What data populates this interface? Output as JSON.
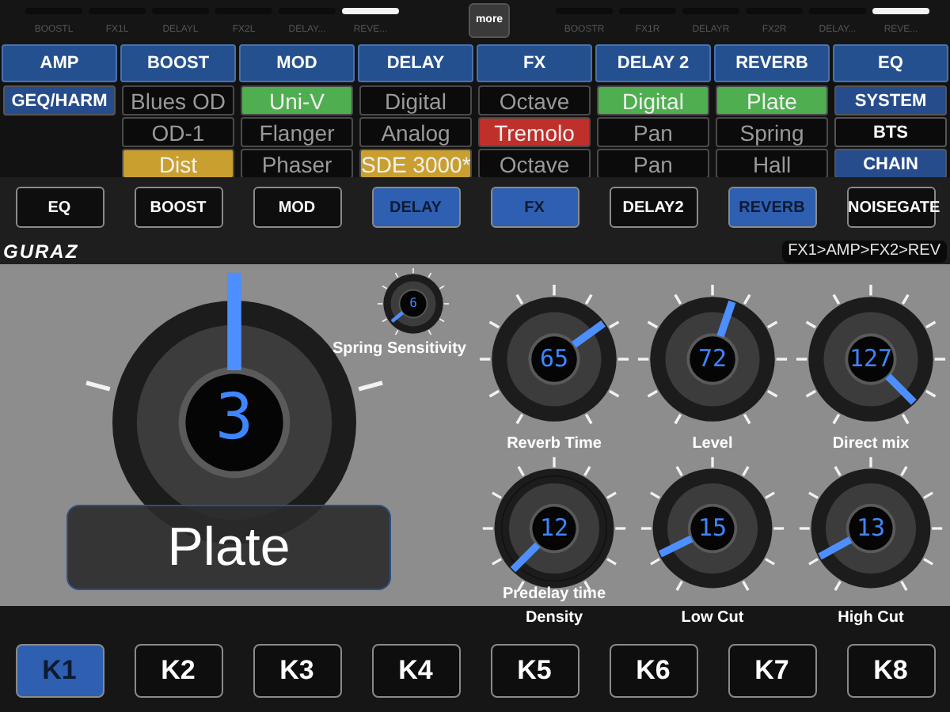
{
  "top_bar": {
    "left_slots": [
      {
        "label": "BOOSTL",
        "selected": false
      },
      {
        "label": "FX1L",
        "selected": false
      },
      {
        "label": "DELAYL",
        "selected": false
      },
      {
        "label": "FX2L",
        "selected": false
      },
      {
        "label": "DELAY...",
        "selected": false
      },
      {
        "label": "REVE...",
        "selected": true
      }
    ],
    "more_button": "more",
    "right_slots": [
      {
        "label": "BOOSTR",
        "selected": false
      },
      {
        "label": "FX1R",
        "selected": false
      },
      {
        "label": "DELAYR",
        "selected": false
      },
      {
        "label": "FX2R",
        "selected": false
      },
      {
        "label": "DELAY...",
        "selected": false
      },
      {
        "label": "REVE...",
        "selected": true
      }
    ]
  },
  "matrix": {
    "columns": [
      {
        "header": "AMP",
        "cells": [
          {
            "kind": "menu",
            "label": "GEQ/HARM",
            "selected": true
          }
        ]
      },
      {
        "header": "BOOST",
        "cells": [
          {
            "kind": "preset",
            "label": "Blues OD"
          },
          {
            "kind": "preset",
            "label": "OD-1"
          },
          {
            "kind": "preset",
            "label": "Dist",
            "color": "#c9a030"
          }
        ]
      },
      {
        "header": "MOD",
        "cells": [
          {
            "kind": "preset",
            "label": "Uni-V",
            "color": "#4fae4f"
          },
          {
            "kind": "preset",
            "label": "Flanger"
          },
          {
            "kind": "preset",
            "label": "Phaser"
          }
        ]
      },
      {
        "header": "DELAY",
        "cells": [
          {
            "kind": "preset",
            "label": "Digital"
          },
          {
            "kind": "preset",
            "label": "Analog"
          },
          {
            "kind": "preset",
            "label": "SDE 3000*",
            "color": "#c9a030"
          }
        ]
      },
      {
        "header": "FX",
        "cells": [
          {
            "kind": "preset",
            "label": "Octave"
          },
          {
            "kind": "preset",
            "label": "Tremolo",
            "color": "#c0302a"
          },
          {
            "kind": "preset",
            "label": "Octave"
          }
        ]
      },
      {
        "header": "DELAY 2",
        "cells": [
          {
            "kind": "preset",
            "label": "Digital",
            "color": "#4fae4f"
          },
          {
            "kind": "preset",
            "label": "Pan"
          },
          {
            "kind": "preset",
            "label": "Pan"
          }
        ]
      },
      {
        "header": "REVERB",
        "cells": [
          {
            "kind": "preset",
            "label": "Plate",
            "color": "#4fae4f"
          },
          {
            "kind": "preset",
            "label": "Spring"
          },
          {
            "kind": "preset",
            "label": "Hall"
          }
        ]
      },
      {
        "header": "EQ",
        "cells": [
          {
            "kind": "menu",
            "label": "SYSTEM",
            "selected": true
          },
          {
            "kind": "menu",
            "label": "BTS",
            "selected": false
          },
          {
            "kind": "menu",
            "label": "CHAIN",
            "selected": true
          }
        ]
      }
    ]
  },
  "effect_buttons": [
    {
      "label": "EQ",
      "selected": false
    },
    {
      "label": "BOOST",
      "selected": false
    },
    {
      "label": "MOD",
      "selected": false
    },
    {
      "label": "DELAY",
      "selected": true
    },
    {
      "label": "FX",
      "selected": true
    },
    {
      "label": "DELAY2",
      "selected": false
    },
    {
      "label": "REVERB",
      "selected": true
    },
    {
      "label": "NOISEGATE",
      "selected": false
    }
  ],
  "logo": "GURAZ",
  "chain": "FX1>AMP>FX2>REV",
  "main_knob": {
    "value": "3",
    "level": 0.5,
    "preset_name": "Plate"
  },
  "spring_knob": {
    "label": "Spring Sensitivity",
    "value": "6",
    "level": 0.02
  },
  "knobs": [
    {
      "label": "Reverb Time",
      "value": "65",
      "level": 0.7
    },
    {
      "label": "Level",
      "value": "72",
      "level": 0.57
    },
    {
      "label": "Direct mix",
      "value": "127",
      "level": 1
    },
    {
      "label": "Density",
      "value": "12",
      "level": 0.0,
      "inner_label": "Predelay time"
    },
    {
      "label": "Low Cut",
      "value": "15",
      "level": 0.07
    },
    {
      "label": "High Cut",
      "value": "13",
      "level": 0.06
    }
  ],
  "keys": [
    {
      "label": "K1",
      "selected": true
    },
    {
      "label": "K2",
      "selected": false
    },
    {
      "label": "K3",
      "selected": false
    },
    {
      "label": "K4",
      "selected": false
    },
    {
      "label": "K5",
      "selected": false
    },
    {
      "label": "K6",
      "selected": false
    },
    {
      "label": "K7",
      "selected": false
    },
    {
      "label": "K8",
      "selected": false
    }
  ]
}
